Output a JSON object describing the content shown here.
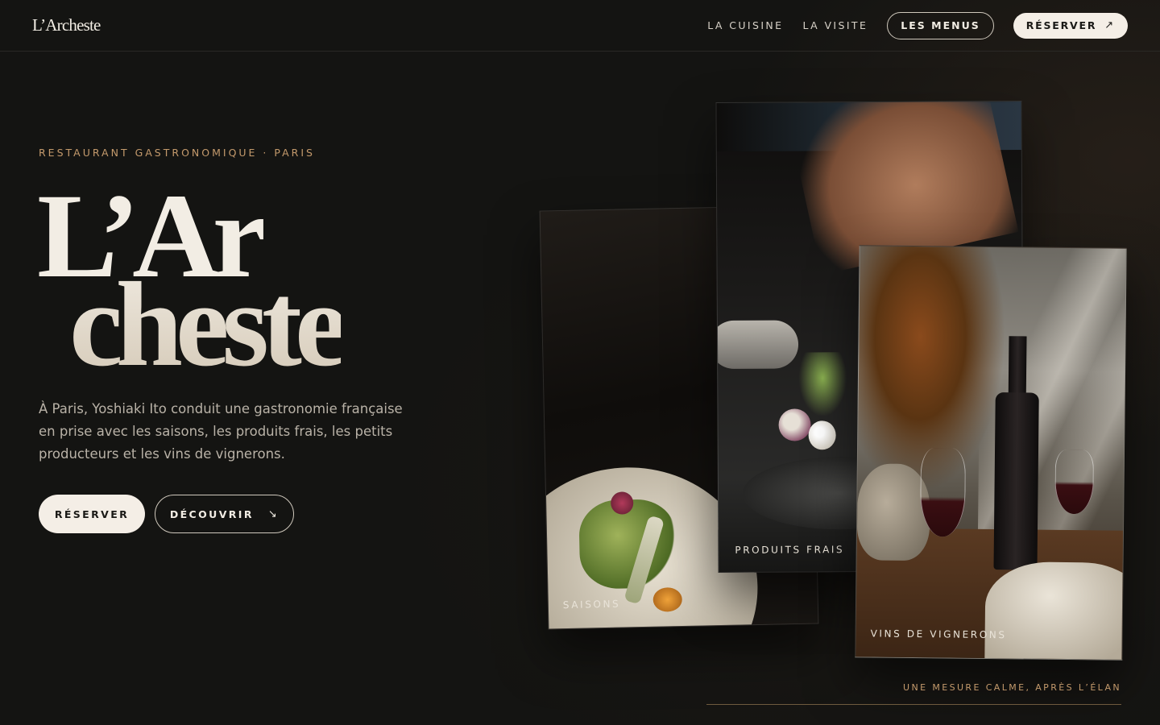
{
  "header": {
    "logo": "L’Archeste",
    "nav": [
      {
        "label": "LA CUISINE"
      },
      {
        "label": "LA VISITE"
      }
    ],
    "menus_button": "LES MENUS",
    "reserve_button": "RÉSERVER",
    "reserve_icon": "↗"
  },
  "hero": {
    "eyebrow": "RESTAURANT GASTRONOMIQUE · PARIS",
    "title_line1": "L’Ar",
    "title_line2": "cheste",
    "lead": "À Paris, Yoshiaki Ito conduit une gastronomie française en prise avec les saisons, les produits frais, les petits producteurs et les vins de vignerons.",
    "primary_button": "RÉSERVER",
    "secondary_button": "DÉCOUVRIR",
    "secondary_icon": "↘"
  },
  "cards": [
    {
      "label": "SAISONS"
    },
    {
      "label": "PRODUITS FRAIS"
    },
    {
      "label": "VINS DE VIGNERONS"
    }
  ],
  "caption": "UNE MESURE CALME, APRÈS L’ÉLAN",
  "colors": {
    "background": "#141412",
    "accent": "#c49a6c",
    "cream": "#f4eee6"
  }
}
